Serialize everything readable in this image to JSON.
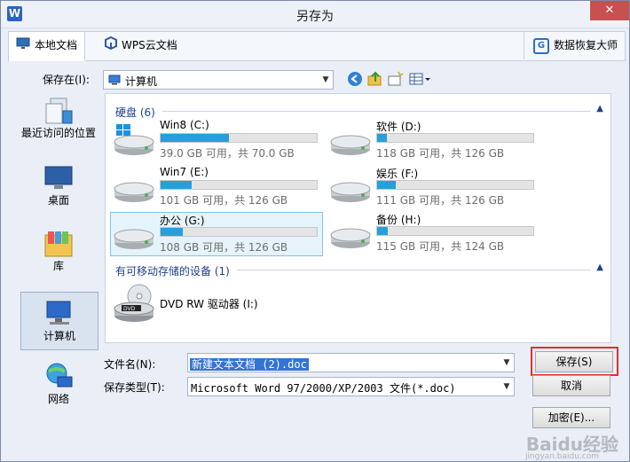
{
  "window": {
    "title": "另存为",
    "close_glyph": "✕",
    "app_icon_letter": "W"
  },
  "tabs": [
    {
      "label": "本地文档",
      "icon": "monitor-icon",
      "active": true
    },
    {
      "label": "WPS云文档",
      "icon": "cloud-cube-icon",
      "active": false
    }
  ],
  "recovery": {
    "label": "数据恢复大师",
    "icon": "recovery-g-icon"
  },
  "save_in": {
    "label": "保存在(I):",
    "value": "计算机",
    "icon": "computer-icon"
  },
  "places": [
    {
      "label": "最近访问的位置",
      "icon": "recent-places-icon"
    },
    {
      "label": "桌面",
      "icon": "desktop-icon"
    },
    {
      "label": "库",
      "icon": "library-icon"
    },
    {
      "label": "计算机",
      "icon": "computer-icon",
      "active": true
    },
    {
      "label": "网络",
      "icon": "network-icon"
    }
  ],
  "groups": {
    "hard_disks": "硬盘 (6)",
    "removable": "有可移动存储的设备 (1)"
  },
  "drives": [
    {
      "name": "Win8 (C:)",
      "info": "39.0 GB 可用，共 70.0 GB",
      "used_fraction": 0.44,
      "icon": "windows-drive-icon"
    },
    {
      "name": "软件 (D:)",
      "info": "118 GB 可用，共 126 GB",
      "used_fraction": 0.06,
      "icon": "hard-drive-icon"
    },
    {
      "name": "Win7 (E:)",
      "info": "101 GB 可用，共 126 GB",
      "used_fraction": 0.2,
      "icon": "hard-drive-icon"
    },
    {
      "name": "娱乐 (F:)",
      "info": "111 GB 可用，共 126 GB",
      "used_fraction": 0.12,
      "icon": "hard-drive-icon"
    },
    {
      "name": "办公 (G:)",
      "info": "108 GB 可用，共 126 GB",
      "used_fraction": 0.14,
      "icon": "hard-drive-icon",
      "selected": true
    },
    {
      "name": "备份 (H:)",
      "info": "115 GB 可用，共 124 GB",
      "used_fraction": 0.07,
      "icon": "hard-drive-icon"
    }
  ],
  "dvd": {
    "name": "DVD RW 驱动器 (I:)",
    "icon": "dvd-drive-icon"
  },
  "filename": {
    "label": "文件名(N):",
    "value": "新建文本文档 (2).doc"
  },
  "filetype": {
    "label": "保存类型(T):",
    "value": "Microsoft Word 97/2000/XP/2003 文件(*.doc)"
  },
  "buttons": {
    "save": "保存(S)",
    "cancel": "取消",
    "encrypt": "加密(E)..."
  },
  "watermark": {
    "text": "Baidu经验",
    "sub": "jingyan.baidu.com"
  },
  "colors": {
    "accent": "#26a0da",
    "highlight": "#e03030",
    "title_bg": "#eef2f8"
  }
}
